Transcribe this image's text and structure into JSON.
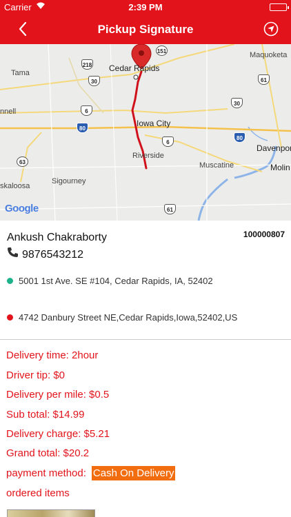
{
  "status_bar": {
    "carrier": "Carrier",
    "time": "2:39 PM"
  },
  "nav": {
    "title": "Pickup Signature",
    "back_icon": "chevron-left-icon",
    "locate_icon": "navigate-icon"
  },
  "map": {
    "labels": {
      "cedar_rapids": "Cedar Rapids",
      "iowa_city": "Iowa City",
      "tama": "Tama",
      "maquoketa": "Maquoketa",
      "riverside": "Riverside",
      "muscatine": "Muscatine",
      "davenport": "Davenpor",
      "moline": "Molin",
      "sigourney": "Sigourney",
      "oskaloosa": "skaloosa",
      "grinnell": "nnell"
    },
    "shields": {
      "us218": "218",
      "us30_w": "30",
      "us151": "151",
      "us61": "61",
      "us6_w": "6",
      "us30_e": "30",
      "i80_w": "80",
      "i80_e": "80",
      "us6_e": "6",
      "ia63": "63",
      "us61_s": "61"
    },
    "attribution": "Google",
    "colors": {
      "route": "#d0101a",
      "pin": "#d92a2a",
      "water": "#8cb4e8"
    }
  },
  "customer": {
    "name": "Ankush Chakraborty",
    "order_id": "100000807",
    "phone": "9876543212",
    "pickup_address": "5001 1st Ave. SE #104, Cedar Rapids, IA, 52402",
    "dropoff_address": "4742 Danbury Street NE,Cedar Rapids,Iowa,52402,US",
    "pickup_color": "#1db38a",
    "dropoff_color": "#e2131b"
  },
  "summary": {
    "delivery_time": "Delivery time: 2hour",
    "driver_tip": "Driver tip: $0",
    "per_mile": "Delivery per mile: $0.5",
    "sub_total": "Sub total: $14.99",
    "delivery_charge": "Delivery charge: $5.21",
    "grand_total": "Grand total: $20.2",
    "payment_label": "payment method:",
    "payment_value": "Cash On Delivery",
    "ordered_items": "ordered items"
  }
}
